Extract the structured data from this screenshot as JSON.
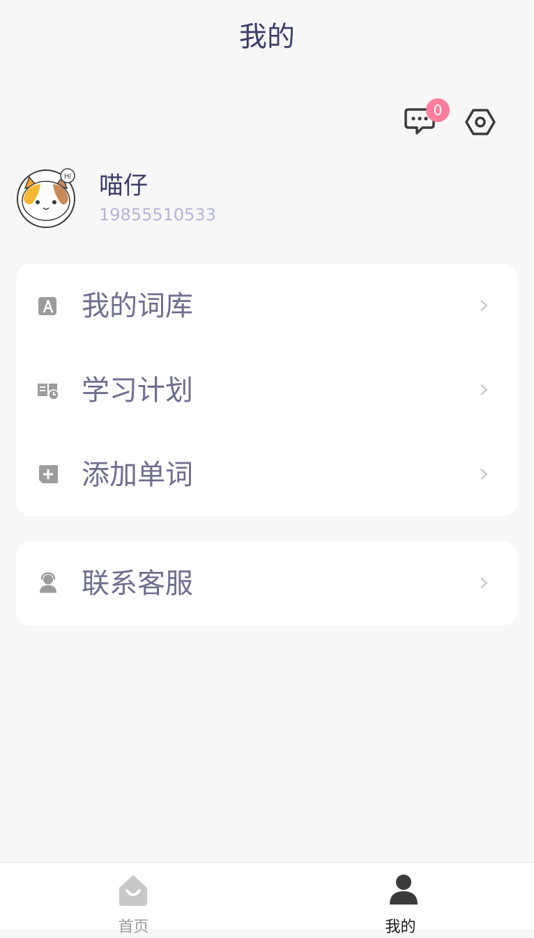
{
  "header": {
    "title": "我的"
  },
  "topbar": {
    "message_badge": "0",
    "message_icon": "chat-bubble-icon",
    "settings_icon": "hex-gear-icon"
  },
  "user": {
    "name": "喵仔",
    "phone": "19855510533",
    "avatar": "cat-avatar"
  },
  "menu": [
    {
      "label": "我的词库",
      "icon": "vocab-book-icon"
    },
    {
      "label": "学习计划",
      "icon": "study-plan-icon"
    },
    {
      "label": "添加单词",
      "icon": "add-word-icon"
    }
  ],
  "support": {
    "label": "联系客服",
    "icon": "customer-service-icon"
  },
  "tabs": [
    {
      "label": "首页",
      "icon": "home-icon",
      "active": false
    },
    {
      "label": "我的",
      "icon": "profile-icon",
      "active": true
    }
  ],
  "colors": {
    "title": "#3d3d6b",
    "item": "#6e6e8f",
    "phone": "#b5b4d6",
    "badge": "#ff7d9e",
    "bg": "#f7f7f7"
  }
}
